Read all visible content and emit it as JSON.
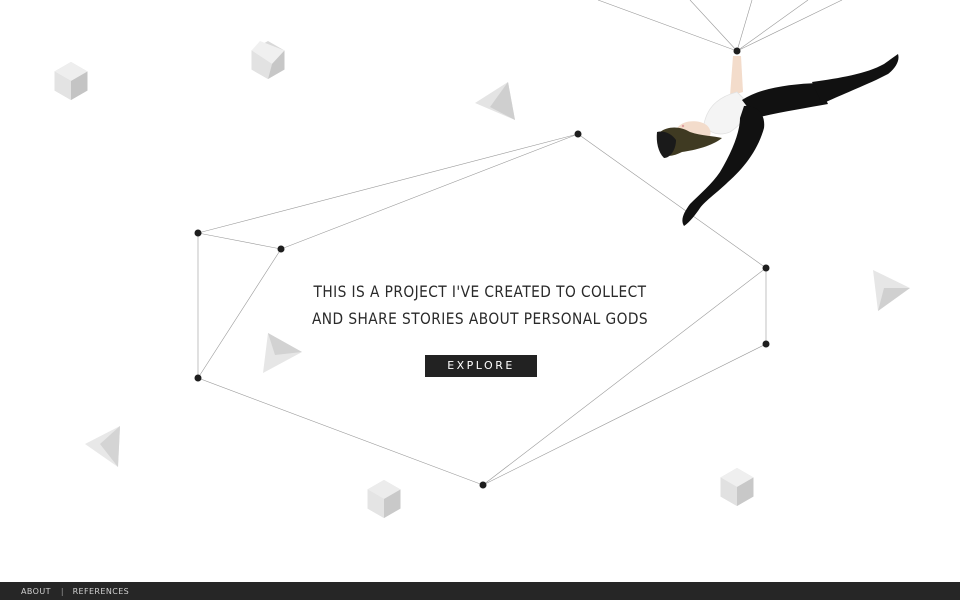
{
  "intro": {
    "line1": "THIS IS A PROJECT I'VE CREATED TO COLLECT",
    "line2": "AND SHARE STORIES ABOUT PERSONAL GODS"
  },
  "explore_label": "EXPLORE",
  "footer": {
    "about_label": "ABOUT",
    "separator": "|",
    "references_label": "REFERENCES"
  },
  "colors": {
    "background": "#ffffff",
    "footer_bg": "#262626",
    "button_bg": "#222222",
    "line": "#9a9a9a",
    "node": "#1e1e1e"
  },
  "decorations": {
    "shapes": [
      "hexagon",
      "hexagon",
      "pyramid",
      "pyramid",
      "triangle",
      "triangle",
      "hexagon",
      "hexagon"
    ],
    "figure": "hanging-acrobat"
  }
}
